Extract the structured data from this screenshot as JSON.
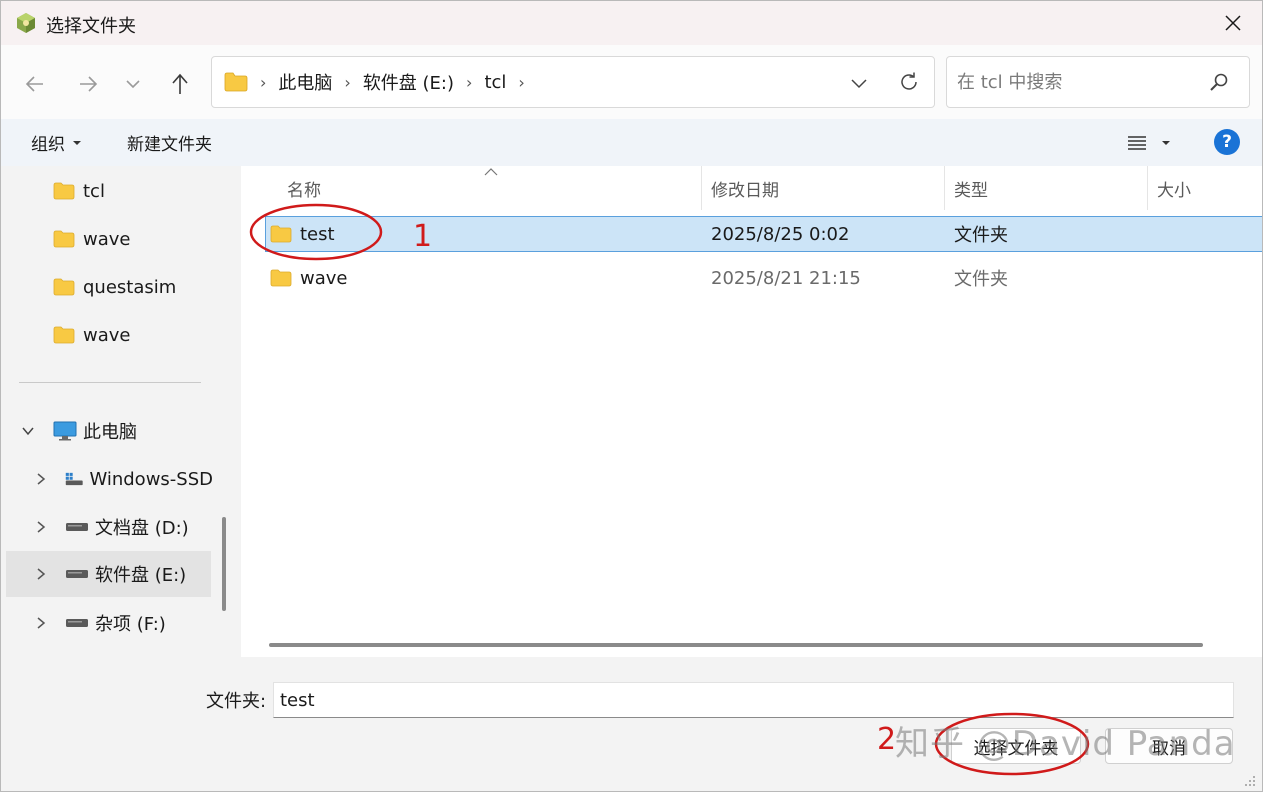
{
  "window": {
    "title": "选择文件夹",
    "icon": "app-cube-icon"
  },
  "nav": {
    "back_icon": "arrow-left-icon",
    "forward_icon": "arrow-right-icon",
    "recent_icon": "chevron-down-icon",
    "up_icon": "arrow-up-icon"
  },
  "address": {
    "crumbs": [
      "此电脑",
      "软件盘 (E:)",
      "tcl"
    ]
  },
  "search": {
    "placeholder": "在 tcl 中搜索"
  },
  "toolbar": {
    "organize_label": "组织",
    "new_folder_label": "新建文件夹",
    "help_label": "?"
  },
  "sidebar": {
    "quick": [
      "tcl",
      "wave",
      "questasim",
      "wave"
    ],
    "this_pc": "此电脑",
    "drives": [
      "Windows-SSD",
      "文档盘 (D:)",
      "软件盘 (E:)",
      "杂项 (F:)"
    ],
    "selected_drive": "软件盘 (E:)"
  },
  "filelist": {
    "columns": [
      "名称",
      "修改日期",
      "类型",
      "大小"
    ],
    "rows": [
      {
        "name": "test",
        "modified": "2025/8/25 0:02",
        "type": "文件夹",
        "size": ""
      },
      {
        "name": "wave",
        "modified": "2025/8/21 21:15",
        "type": "文件夹",
        "size": ""
      }
    ],
    "selected_row": "test"
  },
  "footer": {
    "folder_label": "文件夹:",
    "folder_value": "test",
    "select_button": "选择文件夹",
    "cancel_button": "取消"
  },
  "annotations": {
    "step1": "1",
    "step2": "2",
    "color": "#d01a1a"
  },
  "watermark": "知乎 @David Panda",
  "colors": {
    "accent": "#1a73d6",
    "selection_bg": "#cce4f7",
    "selection_border": "#5aa0dd",
    "folder_yellow": "#f8c943"
  }
}
